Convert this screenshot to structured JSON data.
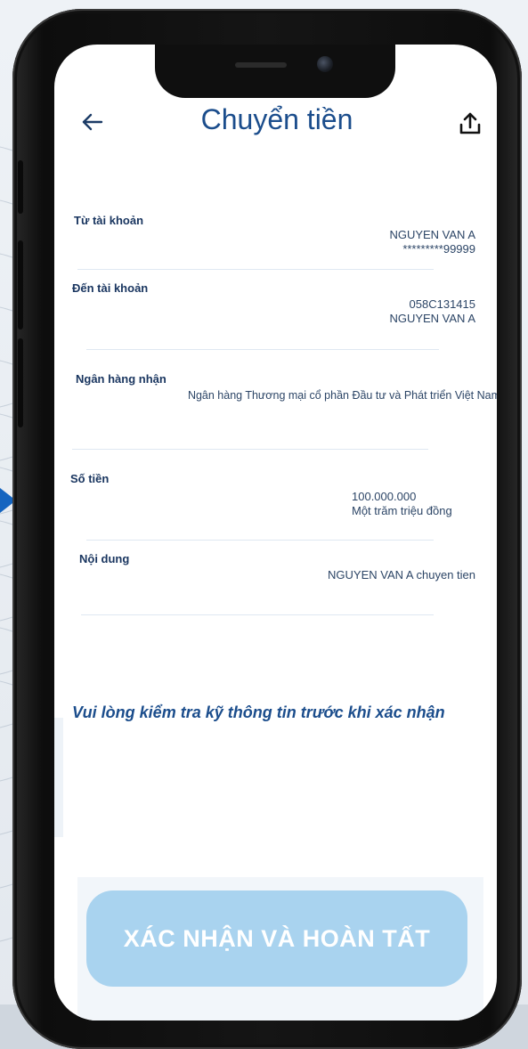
{
  "header": {
    "title": "Chuyển tiền",
    "back_icon": "arrow-left-icon",
    "share_icon": "share-upload-icon"
  },
  "fields": {
    "from_account": {
      "label": "Từ tài khoản",
      "name": "NGUYEN VAN A",
      "number": "*********99999"
    },
    "to_account": {
      "label": "Đến tài khoản",
      "number": "058C131415",
      "name": "NGUYEN VAN A"
    },
    "receiving_bank": {
      "label": "Ngân hàng nhận",
      "value": "Ngân hàng Thương mại cổ phần Đầu tư và Phát triển Việt Nam"
    },
    "amount": {
      "label": "Số tiền",
      "value": "100.000.000",
      "in_words": "Một trăm triệu đồng"
    },
    "content": {
      "label": "Nội dung",
      "value": "NGUYEN VAN A chuyen tien"
    }
  },
  "notice": "Vui lòng kiểm tra kỹ thông tin trước khi xác nhận",
  "confirm_button": {
    "label": "XÁC NHẬN VÀ HOÀN TẤT"
  },
  "colors": {
    "title": "#1b4d8c",
    "button_bg": "#a9d3ef",
    "button_text": "#ffffff",
    "arrow_marker": "#1565c0"
  }
}
